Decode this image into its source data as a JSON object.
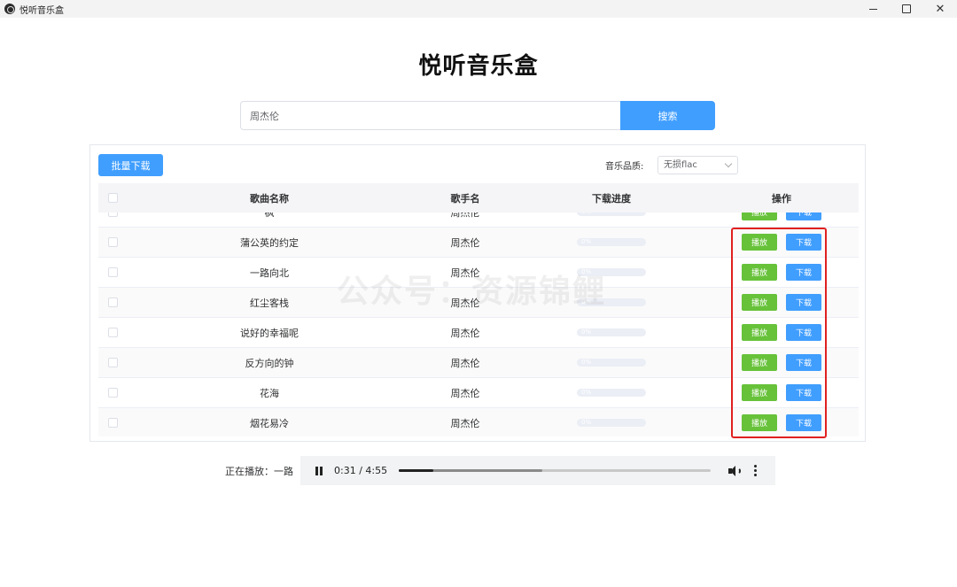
{
  "window": {
    "title": "悦听音乐盒",
    "controls": {
      "close": "✕"
    }
  },
  "page": {
    "title": "悦听音乐盒"
  },
  "search": {
    "value": "周杰伦",
    "button_label": "搜索"
  },
  "toolbar": {
    "batch_download_label": "批量下载",
    "quality_label": "音乐品质:",
    "quality_selected": "无损flac"
  },
  "table": {
    "headers": {
      "name": "歌曲名称",
      "artist": "歌手名",
      "progress": "下载进度",
      "actions": "操作"
    },
    "rows": [
      {
        "name": "枫",
        "artist": "周杰伦",
        "progress_text": "0%",
        "progress": 0
      },
      {
        "name": "蒲公英的约定",
        "artist": "周杰伦",
        "progress_text": "0%",
        "progress": 0
      },
      {
        "name": "一路向北",
        "artist": "周杰伦",
        "progress_text": "0%",
        "progress": 0
      },
      {
        "name": "红尘客栈",
        "artist": "周杰伦",
        "progress_text": "0%",
        "progress": 0
      },
      {
        "name": "说好的幸福呢",
        "artist": "周杰伦",
        "progress_text": "0%",
        "progress": 0
      },
      {
        "name": "反方向的钟",
        "artist": "周杰伦",
        "progress_text": "0%",
        "progress": 0
      },
      {
        "name": "花海",
        "artist": "周杰伦",
        "progress_text": "0%",
        "progress": 0
      },
      {
        "name": "烟花易冷",
        "artist": "周杰伦",
        "progress_text": "0%",
        "progress": 0
      }
    ],
    "play_label": "播放",
    "download_label": "下载"
  },
  "watermark": "公众号：资源锦鲤",
  "player": {
    "now_playing_label": "正在播放：一路",
    "time": "0:31 / 4:55",
    "played_fraction": 0.11,
    "buffered_fraction": 0.46
  },
  "colors": {
    "primary": "#409eff",
    "success": "#67c23a",
    "highlight": "#e02020"
  }
}
